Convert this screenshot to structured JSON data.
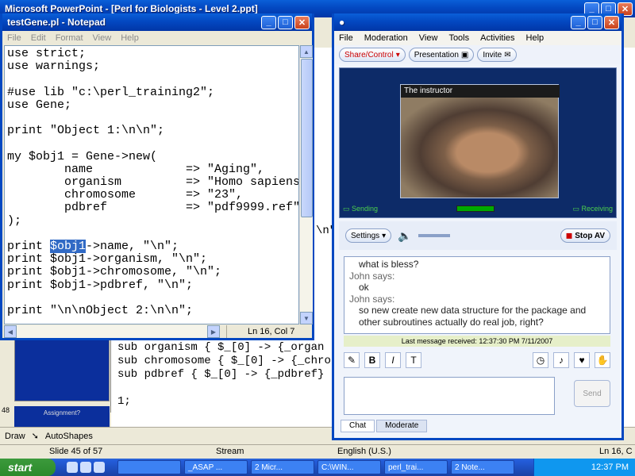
{
  "powerpoint": {
    "title": "Microsoft PowerPoint - [Perl for Biologists - Level 2.ppt]",
    "slide_code": "sub organism { $_[0] -> {_organ\nsub chromosome { $_[0] -> {_chro\nsub pdbref { $_[0] -> {_pdbref}\n\n1;",
    "thumb_num": "48",
    "thumb_title": "Assignment?",
    "draw_label": "Draw",
    "autoshapes_label": "AutoShapes",
    "status_slide": "Slide 45 of 57",
    "status_design": "Stream",
    "status_lang": "English (U.S.)",
    "side_code_1": "\\n\";",
    "side_code_2": "Ln 16, C"
  },
  "notepad": {
    "title": "testGene.pl - Notepad",
    "menu": [
      "File",
      "Edit",
      "Format",
      "View",
      "Help"
    ],
    "code_before_sel": "use strict;\nuse warnings;\n\n#use lib \"c:\\perl_training2\";\nuse Gene;\n\nprint \"Object 1:\\n\\n\";\n\nmy $obj1 = Gene->new(\n        name             => \"Aging\",\n        organism         => \"Homo sapiens\",\n        chromosome       => \"23\",\n        pdbref           => \"pdf9999.ref\"\n);\n\nprint ",
    "code_selected": "$obj1",
    "code_after_sel": "->name, \"\\n\";\nprint $obj1->organism, \"\\n\";\nprint $obj1->chromosome, \"\\n\";\nprint $obj1->pdbref, \"\\n\";\n\nprint \"\\n\\nObject 2:\\n\\n\";",
    "status": "Ln 16, Col 7"
  },
  "meeting": {
    "menu": [
      "File",
      "Moderation",
      "View",
      "Tools",
      "Activities",
      "Help"
    ],
    "toolbar": [
      "Share/Control",
      "Presentation",
      "Invite"
    ],
    "video_title": "The instructor",
    "sending": "Sending",
    "receiving": "Receiving",
    "settings_label": "Settings",
    "stop_av_label": "Stop AV",
    "chat": [
      {
        "type": "msg",
        "text": "what is bless?"
      },
      {
        "type": "who",
        "text": "John says:"
      },
      {
        "type": "msg",
        "text": "ok"
      },
      {
        "type": "who",
        "text": "John says:"
      },
      {
        "type": "msg",
        "text": "so new create new data structure for the package and"
      },
      {
        "type": "msg",
        "text": "other subroutines actually do real job, right?"
      }
    ],
    "last_message": "Last message received: 12:37:30 PM 7/11/2007",
    "send_label": "Send",
    "tabs": [
      "Chat",
      "Moderate"
    ]
  },
  "taskbar": {
    "start_label": "start",
    "tasks": [
      "",
      "_ASAP ...",
      "2 Micr...",
      "C:\\WIN...",
      "perl_trai...",
      "2 Note..."
    ],
    "time": "12:37 PM"
  }
}
